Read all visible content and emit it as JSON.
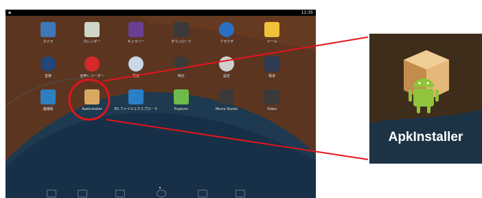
{
  "status_bar": {
    "time": "11:35",
    "left_icon": "notification-icon"
  },
  "apps": [
    {
      "label": "カメラ",
      "icon": "camera-icon",
      "color": "#3f78b6"
    },
    {
      "label": "カレンダー",
      "icon": "calendar-icon",
      "color": "#cfd6c8"
    },
    {
      "label": "ギャラリー",
      "icon": "gallery-icon",
      "color": "#6b3f93"
    },
    {
      "label": "ダウンロード",
      "icon": "download-icon",
      "color": "#3a3a3a"
    },
    {
      "label": "ブラウザ",
      "icon": "browser-globe-icon",
      "color": "#2a6fc2"
    },
    {
      "label": "メール",
      "icon": "mail-icon",
      "color": "#f0c23a"
    },
    {
      "label": "音楽",
      "icon": "music-icon",
      "color": "#20467a"
    },
    {
      "label": "音声レコーダー",
      "icon": "voice-recorder-icon",
      "color": "#d62a2a"
    },
    {
      "label": "検索",
      "icon": "search-icon",
      "color": "#c9d8e6"
    },
    {
      "label": "時計",
      "icon": "clock-icon",
      "color": "#3a3a3a"
    },
    {
      "label": "設定",
      "icon": "settings-gear-icon",
      "color": "#cfcfcf"
    },
    {
      "label": "電卓",
      "icon": "calculator-icon",
      "color": "#2e3a52"
    },
    {
      "label": "連絡帳",
      "icon": "contacts-icon",
      "color": "#2f7fbf"
    },
    {
      "label": "ApkInstaller",
      "icon": "apkinstaller-icon",
      "color": "#d9a862"
    },
    {
      "label": "ES ファイルエクスプローラ",
      "icon": "es-file-explorer-icon",
      "color": "#2a7fc9"
    },
    {
      "label": "Explorer",
      "icon": "explorer-icon",
      "color": "#6dbb4a"
    },
    {
      "label": "Movie Studio",
      "icon": "movie-studio-icon",
      "color": "#3a3a3a"
    },
    {
      "label": "Video",
      "icon": "video-icon",
      "color": "#3a3a3a"
    }
  ],
  "callout": {
    "label": "ApkInstaller",
    "highlight_color": "#e3141b"
  },
  "navigation": {
    "buttons": [
      "back-icon",
      "home-icon",
      "recents-icon"
    ]
  }
}
